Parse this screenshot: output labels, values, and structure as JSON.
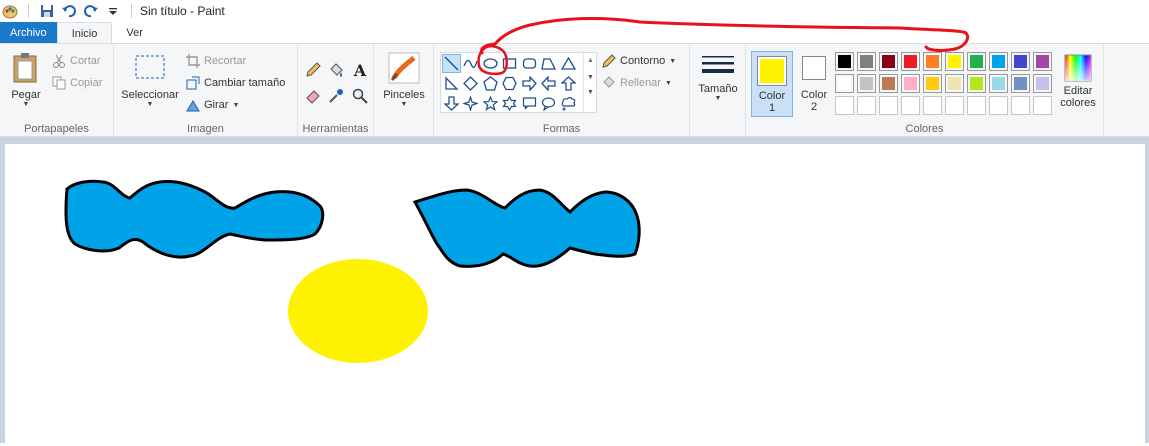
{
  "window": {
    "title": "Sin título - Paint"
  },
  "tabs": [
    {
      "label": "Archivo"
    },
    {
      "label": "Inicio"
    },
    {
      "label": "Ver"
    }
  ],
  "clipboard": {
    "paste": "Pegar",
    "cut": "Cortar",
    "copy": "Copiar",
    "group": "Portapapeles"
  },
  "image": {
    "select": "Seleccionar",
    "crop": "Recortar",
    "resize": "Cambiar tamaño",
    "rotate": "Girar",
    "group": "Imagen"
  },
  "tools": {
    "group": "Herramientas",
    "icons": [
      "pencil-icon",
      "fill-icon",
      "text-icon",
      "eraser-icon",
      "color-picker-icon",
      "magnifier-icon"
    ]
  },
  "brushes": {
    "label": "Pinceles"
  },
  "shapes": {
    "outline": "Contorno",
    "fill": "Rellenar",
    "group": "Formas",
    "selected": "oval"
  },
  "size": {
    "label": "Tamaño"
  },
  "colors": {
    "color1_label": "Color",
    "color1_num": "1",
    "color2_label": "Color",
    "color2_num": "2",
    "edit_label_1": "Editar",
    "edit_label_2": "colores",
    "group": "Colores",
    "color1": "#fff200",
    "color2": "#ffffff",
    "palette_row1": [
      "#000000",
      "#7f7f7f",
      "#880015",
      "#ed1c24",
      "#ff7f27",
      "#fff200",
      "#22b14c",
      "#00a2e8",
      "#3f48cc",
      "#a349a4"
    ],
    "palette_row2": [
      "#ffffff",
      "#c3c3c3",
      "#b97a57",
      "#ffaec9",
      "#ffc90e",
      "#efe4b0",
      "#b5e61d",
      "#99d9ea",
      "#7092be",
      "#c8bfe7"
    ]
  },
  "drawing": {
    "fill_blue": "#00a2e8",
    "fill_yellow": "#fff200",
    "annotation": "#e8131a"
  }
}
